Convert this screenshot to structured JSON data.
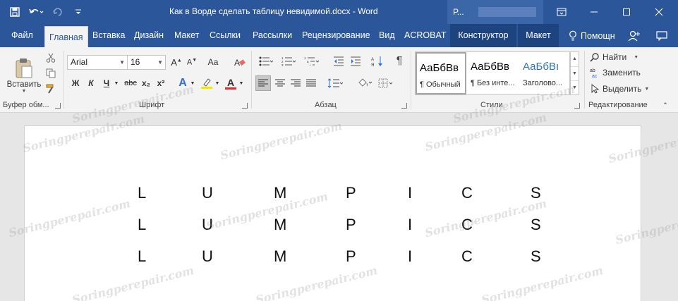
{
  "window": {
    "title": "Как в Ворде сделать таблицу невидимой.docx - Word",
    "account_initial": "Р..."
  },
  "tabs": [
    {
      "label": "Файл"
    },
    {
      "label": "Главная"
    },
    {
      "label": "Вставка"
    },
    {
      "label": "Дизайн"
    },
    {
      "label": "Макет"
    },
    {
      "label": "Ссылки"
    },
    {
      "label": "Рассылки"
    },
    {
      "label": "Рецензирование"
    },
    {
      "label": "Вид"
    },
    {
      "label": "ACROBAT"
    },
    {
      "label": "Конструктор"
    },
    {
      "label": "Макет"
    }
  ],
  "tell_me": "Помощн",
  "ribbon": {
    "clipboard": {
      "paste_label": "Вставить",
      "group_label": "Буфер обм..."
    },
    "font": {
      "name": "Arial",
      "size": "16",
      "group_label": "Шрифт",
      "bold": "Ж",
      "italic": "К",
      "underline": "Ч",
      "strike": "abc",
      "subscript": "x₂",
      "superscript": "x²",
      "effects": "A",
      "color": "A"
    },
    "paragraph": {
      "group_label": "Абзац"
    },
    "styles": {
      "group_label": "Стили",
      "items": [
        {
          "sample": "АаБбВв",
          "name": "¶ Обычный"
        },
        {
          "sample": "АаБбВв",
          "name": "¶ Без инте..."
        },
        {
          "sample": "АаБбВı",
          "name": "Заголово..."
        }
      ]
    },
    "editing": {
      "group_label": "Редактирование",
      "find": "Найти",
      "replace": "Заменить",
      "select": "Выделить"
    }
  },
  "document": {
    "rows": [
      [
        "L",
        "U",
        "M",
        "P",
        "I",
        "C",
        "S"
      ],
      [
        "L",
        "U",
        "M",
        "P",
        "I",
        "C",
        "S"
      ],
      [
        "L",
        "U",
        "M",
        "P",
        "I",
        "C",
        "S"
      ]
    ]
  },
  "watermark": "Soringperepair.com",
  "colors": {
    "accent": "#2b579a",
    "ribbon": "#f3f3f3",
    "canvas": "#e6e6e6"
  }
}
